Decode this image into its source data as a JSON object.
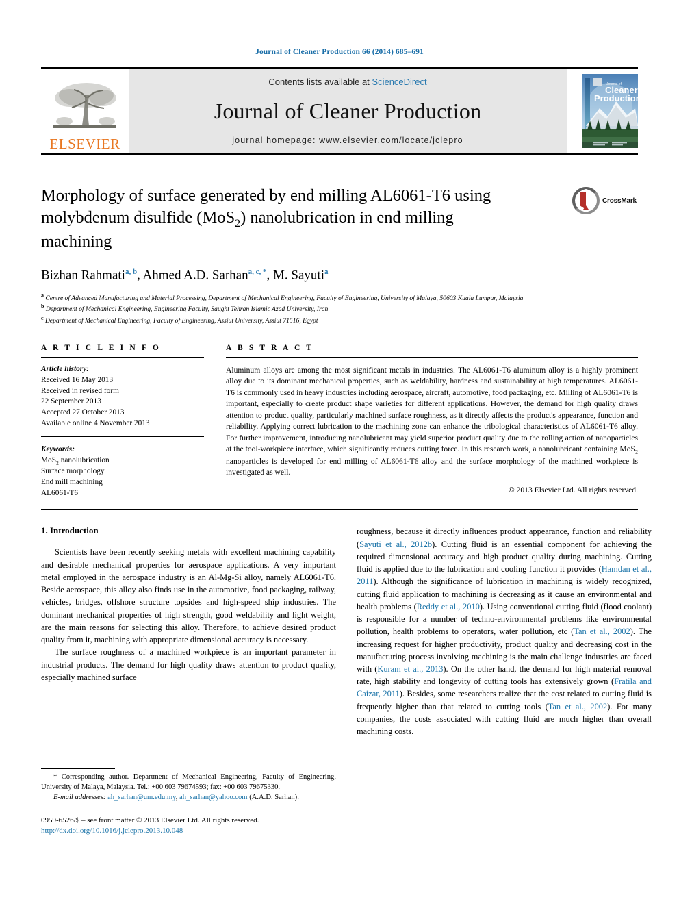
{
  "running_head": "Journal of Cleaner Production 66 (2014) 685–691",
  "banner": {
    "publisher": "ELSEVIER",
    "contents_prefix": "Contents lists available at ",
    "contents_link": "ScienceDirect",
    "journal_title": "Journal of Cleaner Production",
    "homepage": "journal homepage: www.elsevier.com/locate/jclepro",
    "cover_line1": "Journal of",
    "cover_line2": "Cleaner",
    "cover_line3": "Production"
  },
  "article": {
    "title_line1": "Morphology of surface generated by end milling AL6061-T6 using",
    "title_line2_a": "molybdenum disulfide (MoS",
    "title_line2_sub": "2",
    "title_line2_b": ") nanolubrication in end milling",
    "title_line3": "machining",
    "crossmark_label": "CrossMark",
    "authors_plain": "Bizhan Rahmati a, b, Ahmed A.D. Sarhan a, c, *, M. Sayuti a",
    "author1": "Bizhan Rahmati",
    "author1_sup": "a, b",
    "author2": "Ahmed A.D. Sarhan",
    "author2_sup": "a, c, *",
    "author3": "M. Sayuti",
    "author3_sup": "a",
    "affiliation_a": "Centre of Advanced Manufacturing and Material Processing, Department of Mechanical Engineering, Faculty of Engineering, University of Malaya, 50603 Kuala Lumpur, Malaysia",
    "affiliation_b": "Department of Mechanical Engineering, Engineering Faculty, Saught Tehran Islamic Azad University, Iran",
    "affiliation_c": "Department of Mechanical Engineering, Faculty of Engineering, Assiut University, Assiut 71516, Egypt",
    "affil_a_marker": "a",
    "affil_b_marker": "b",
    "affil_c_marker": "c"
  },
  "article_info": {
    "heading": "A R T I C L E  I N F O",
    "history_label": "Article history:",
    "history": [
      "Received 16 May 2013",
      "Received in revised form",
      "22 September 2013",
      "Accepted 27 October 2013",
      "Available online 4 November 2013"
    ],
    "keywords_label": "Keywords:",
    "keyword_1_a": "MoS",
    "keyword_1_sub": "2",
    "keyword_1_b": " nanolubrication",
    "keyword_2": "Surface morphology",
    "keyword_3": "End mill machining",
    "keyword_4": "AL6061-T6"
  },
  "abstract": {
    "heading": "A B S T R A C T",
    "text_part1": "Aluminum alloys are among the most significant metals in industries. The AL6061-T6 aluminum alloy is a highly prominent alloy due to its dominant mechanical properties, such as weldability, hardness and sustainability at high temperatures. AL6061-T6 is commonly used in heavy industries including aerospace, aircraft, automotive, food packaging, etc. Milling of AL6061-T6 is important, especially to create product shape varieties for different applications. However, the demand for high quality draws attention to product quality, particularly machined surface roughness, as it directly affects the product's appearance, function and reliability. Applying correct lubrication to the machining zone can enhance the tribological characteristics of AL6061-T6 alloy. For further improvement, introducing nanolubricant may yield superior product quality due to the rolling action of nanoparticles at the tool-workpiece interface, which significantly reduces cutting force. In this research work, a nanolubricant containing MoS",
    "text_sub": "2",
    "text_part2": " nanoparticles is developed for end milling of AL6061-T6 alloy and the surface morphology of the machined workpiece is investigated as well.",
    "copyright": "© 2013 Elsevier Ltd. All rights reserved."
  },
  "introduction": {
    "section_title": "1. Introduction",
    "left_para1": "Scientists have been recently seeking metals with excellent machining capability and desirable mechanical properties for aerospace applications. A very important metal employed in the aerospace industry is an Al-Mg-Si alloy, namely AL6061-T6. Beside aerospace, this alloy also finds use in the automotive, food packaging, railway, vehicles, bridges, offshore structure topsides and high-speed ship industries. The dominant mechanical properties of high strength, good weldability and light weight, are the main reasons for selecting this alloy. Therefore, to achieve desired product quality from it, machining with appropriate dimensional accuracy is necessary.",
    "left_para2": "The surface roughness of a machined workpiece is an important parameter in industrial products. The demand for high quality draws attention to product quality, especially machined surface",
    "right_seg1": "roughness, because it directly influences product appearance, function and reliability (",
    "right_cite1": "Sayuti et al., 2012b",
    "right_seg2": "). Cutting fluid is an essential component for achieving the required dimensional accuracy and high product quality during machining. Cutting fluid is applied due to the lubrication and cooling function it provides (",
    "right_cite2": "Hamdan et al., 2011",
    "right_seg3": "). Although the significance of lubrication in machining is widely recognized, cutting fluid application to machining is decreasing as it cause an environmental and health problems (",
    "right_cite3": "Reddy et al., 2010",
    "right_seg4": "). Using conventional cutting fluid (flood coolant) is responsible for a number of techno-environmental problems like environmental pollution, health problems to operators, water pollution, etc (",
    "right_cite4": "Tan et al., 2002",
    "right_seg5": "). The increasing request for higher productivity, product quality and decreasing cost in the manufacturing process involving machining is the main challenge industries are faced with (",
    "right_cite5": "Kuram et al., 2013",
    "right_seg6": "). On the other hand, the demand for high material removal rate, high stability and longevity of cutting tools has extensively grown (",
    "right_cite6": "Fratila and Caizar, 2011",
    "right_seg7": "). Besides, some researchers realize that the cost related to cutting fluid is frequently higher than that related to cutting tools (",
    "right_cite7": "Tan et al., 2002",
    "right_seg8": "). For many companies, the costs associated with cutting fluid are much higher than overall machining costs."
  },
  "footnote": {
    "corresponding": "* Corresponding author. Department of Mechanical Engineering, Faculty of Engineering, University of Malaya, Malaysia. Tel.: +00 603 79674593; fax: +00 603 79675330.",
    "email_label": "E-mail addresses:",
    "email_1": "ah_sarhan@um.edu.my",
    "email_2": "ah_sarhan@yahoo.com",
    "email_suffix": "(A.A.D. Sarhan).",
    "issn_line": "0959-6526/$ – see front matter © 2013 Elsevier Ltd. All rights reserved.",
    "doi_line": "http://dx.doi.org/10.1016/j.jclepro.2013.10.048"
  },
  "colors": {
    "link_blue": "#1a73a8",
    "header_blue": "#1a6ea8",
    "elsevier_orange": "#E87722",
    "banner_grey": "#e6e6e6",
    "crossmark_red": "#b4302a"
  }
}
